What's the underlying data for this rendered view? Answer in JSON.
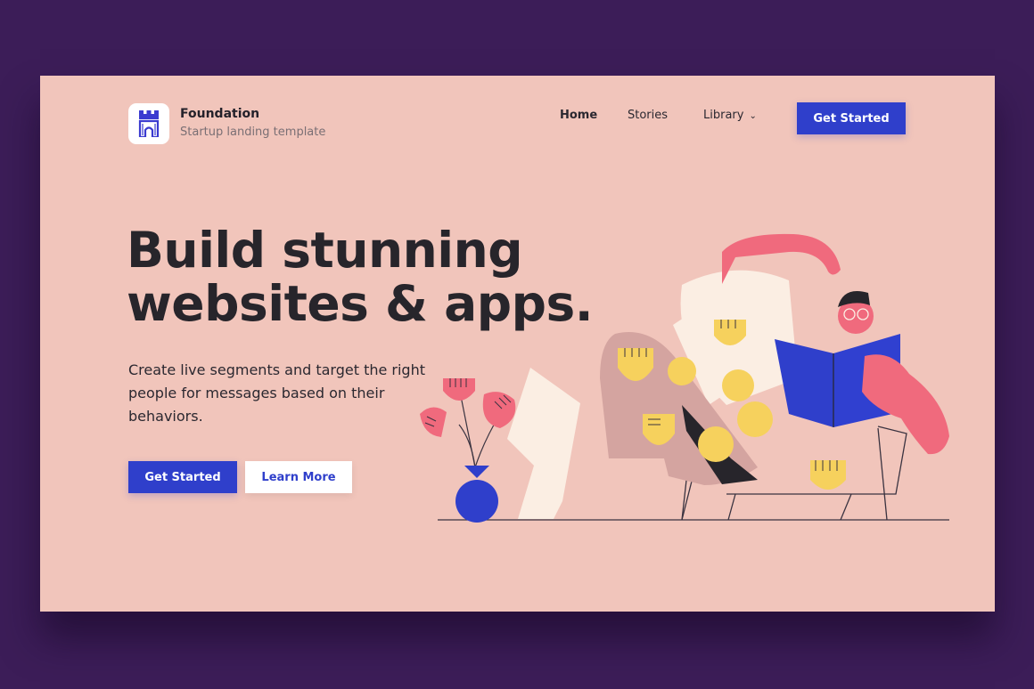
{
  "brand": {
    "name": "Foundation",
    "tagline": "Startup landing template",
    "logo_icon": "castle-tower-icon"
  },
  "nav": {
    "items": [
      {
        "label": "Home",
        "active": true
      },
      {
        "label": "Stories",
        "active": false
      },
      {
        "label": "Library",
        "active": false,
        "dropdown": true
      }
    ],
    "cta_label": "Get Started"
  },
  "hero": {
    "headline_line1": "Build stunning",
    "headline_line2": "websites & apps.",
    "subtext": "Create live segments and target the right people for messages based on their behaviors.",
    "primary_button": "Get Started",
    "secondary_button": "Learn More"
  },
  "colors": {
    "page_background": "#3c1d58",
    "card_background": "#f1c5bb",
    "accent_blue": "#2f3fcb",
    "heading": "#27252b",
    "pink": "#f06a7d",
    "yellow": "#f6d15d",
    "cream": "#fbeee3"
  },
  "illustration": {
    "subject": "person reading a book in a chair next to a potted plant",
    "icon": "reading-person-illustration"
  }
}
